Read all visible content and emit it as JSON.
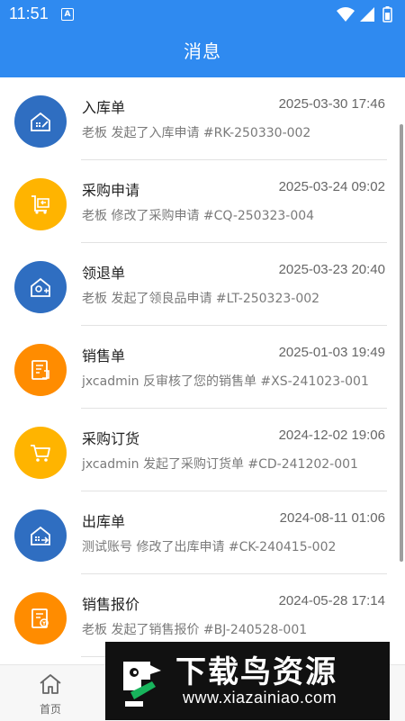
{
  "status_bar": {
    "time": "11:51",
    "notification_icon": "A"
  },
  "header": {
    "title": "消息"
  },
  "colors": {
    "brand_blue": "#2f8af0",
    "icon_blue": "#2f6ec1",
    "icon_yellow": "#ffb400",
    "icon_orange": "#ff8c00"
  },
  "messages": [
    {
      "title": "入库单",
      "time": "2025-03-30 17:46",
      "desc": "老板 发起了入库申请 #RK-250330-002",
      "icon": "warehouse-in-icon",
      "color": "#2f6ec1"
    },
    {
      "title": "采购申请",
      "time": "2025-03-24 09:02",
      "desc": "老板 修改了采购申请 #CQ-250323-004",
      "icon": "purchase-request-icon",
      "color": "#ffb400"
    },
    {
      "title": "领退单",
      "time": "2025-03-23 20:40",
      "desc": "老板 发起了领良品申请 #LT-250323-002",
      "icon": "requisition-return-icon",
      "color": "#2f6ec1"
    },
    {
      "title": "销售单",
      "time": "2025-01-03 19:49",
      "desc": "jxcadmin 反审核了您的销售单 #XS-241023-001",
      "icon": "sales-order-icon",
      "color": "#ff8c00"
    },
    {
      "title": "采购订货",
      "time": "2024-12-02 19:06",
      "desc": "jxcadmin 发起了采购订货单 #CD-241202-001",
      "icon": "cart-icon",
      "color": "#ffb400"
    },
    {
      "title": "出库单",
      "time": "2024-08-11 01:06",
      "desc": "测试账号 修改了出库申请 #CK-240415-002",
      "icon": "warehouse-out-icon",
      "color": "#2f6ec1"
    },
    {
      "title": "销售报价",
      "time": "2024-05-28 17:14",
      "desc": "老板 发起了销售报价 #BJ-240528-001",
      "icon": "sales-quote-icon",
      "color": "#ff8c00"
    }
  ],
  "tabbar": {
    "home_label": "首页"
  },
  "watermark": {
    "title": "下载鸟资源",
    "url": "www.xiazainiao.com"
  }
}
